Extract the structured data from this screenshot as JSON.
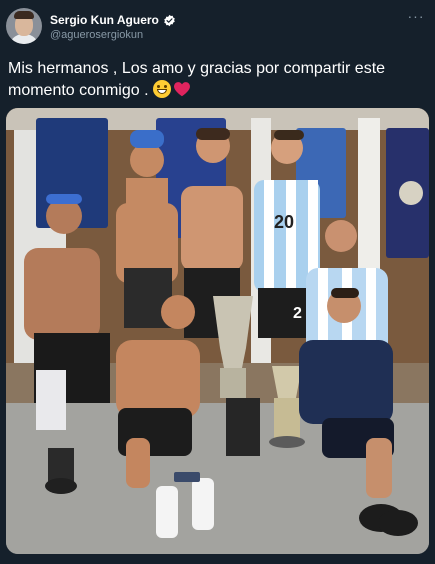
{
  "tweet": {
    "author_name": "Sergio Kun Aguero",
    "author_handle": "@aguerosergiokun",
    "text": "Mis hermanos , Los amo y gracias por compartir este momento conmigo .",
    "emojis": [
      "grinning-face-icon",
      "red-heart-icon"
    ],
    "verified": true
  },
  "photo": {
    "description_icon": "team-celebration-photo",
    "kit_numbers": [
      "20",
      "2"
    ]
  },
  "colors": {
    "background": "#15202b",
    "text": "#ffffff",
    "secondary_text": "#8899a6",
    "verified": "#ffffff"
  }
}
